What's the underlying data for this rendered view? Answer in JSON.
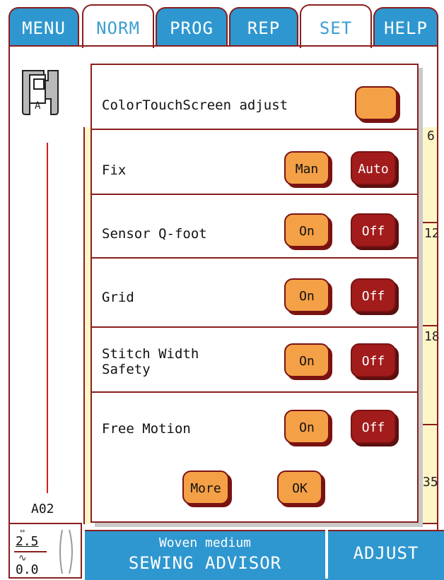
{
  "tabs": [
    {
      "label": "MENU"
    },
    {
      "label": "NORM"
    },
    {
      "label": "PROG"
    },
    {
      "label": "REP"
    },
    {
      "label": "SET"
    },
    {
      "label": "HELP"
    }
  ],
  "left_panel": {
    "stitch_code": "A02",
    "foot_label": "A",
    "width_value": "2.5",
    "length_value": "0.0"
  },
  "right_numbers": [
    "6",
    "12",
    "18",
    "35"
  ],
  "settings_panel": {
    "rows": [
      {
        "label": "ColorTouchScreen adjust"
      },
      {
        "label": "Fix",
        "option_a": "Man",
        "option_b": "Auto"
      },
      {
        "label": "Sensor Q-foot",
        "option_a": "On",
        "option_b": "Off"
      },
      {
        "label": "Grid",
        "option_a": "On",
        "option_b": "Off"
      },
      {
        "label_line1": "Stitch Width",
        "label_line2": "Safety",
        "option_a": "On",
        "option_b": "Off"
      },
      {
        "label": "Free Motion",
        "option_a": "On",
        "option_b": "Off"
      }
    ],
    "more_label": "More",
    "ok_label": "OK"
  },
  "bottom_bar": {
    "fabric": "Woven medium",
    "advisor": "SEWING ADVISOR",
    "adjust": "ADJUST"
  },
  "colors": {
    "tab_blue": "#2f97cf",
    "border_red": "#8a1e1e",
    "button_orange": "#f4a046",
    "button_dark_red": "#a21c1c",
    "strip_yellow": "#fff6c8"
  }
}
